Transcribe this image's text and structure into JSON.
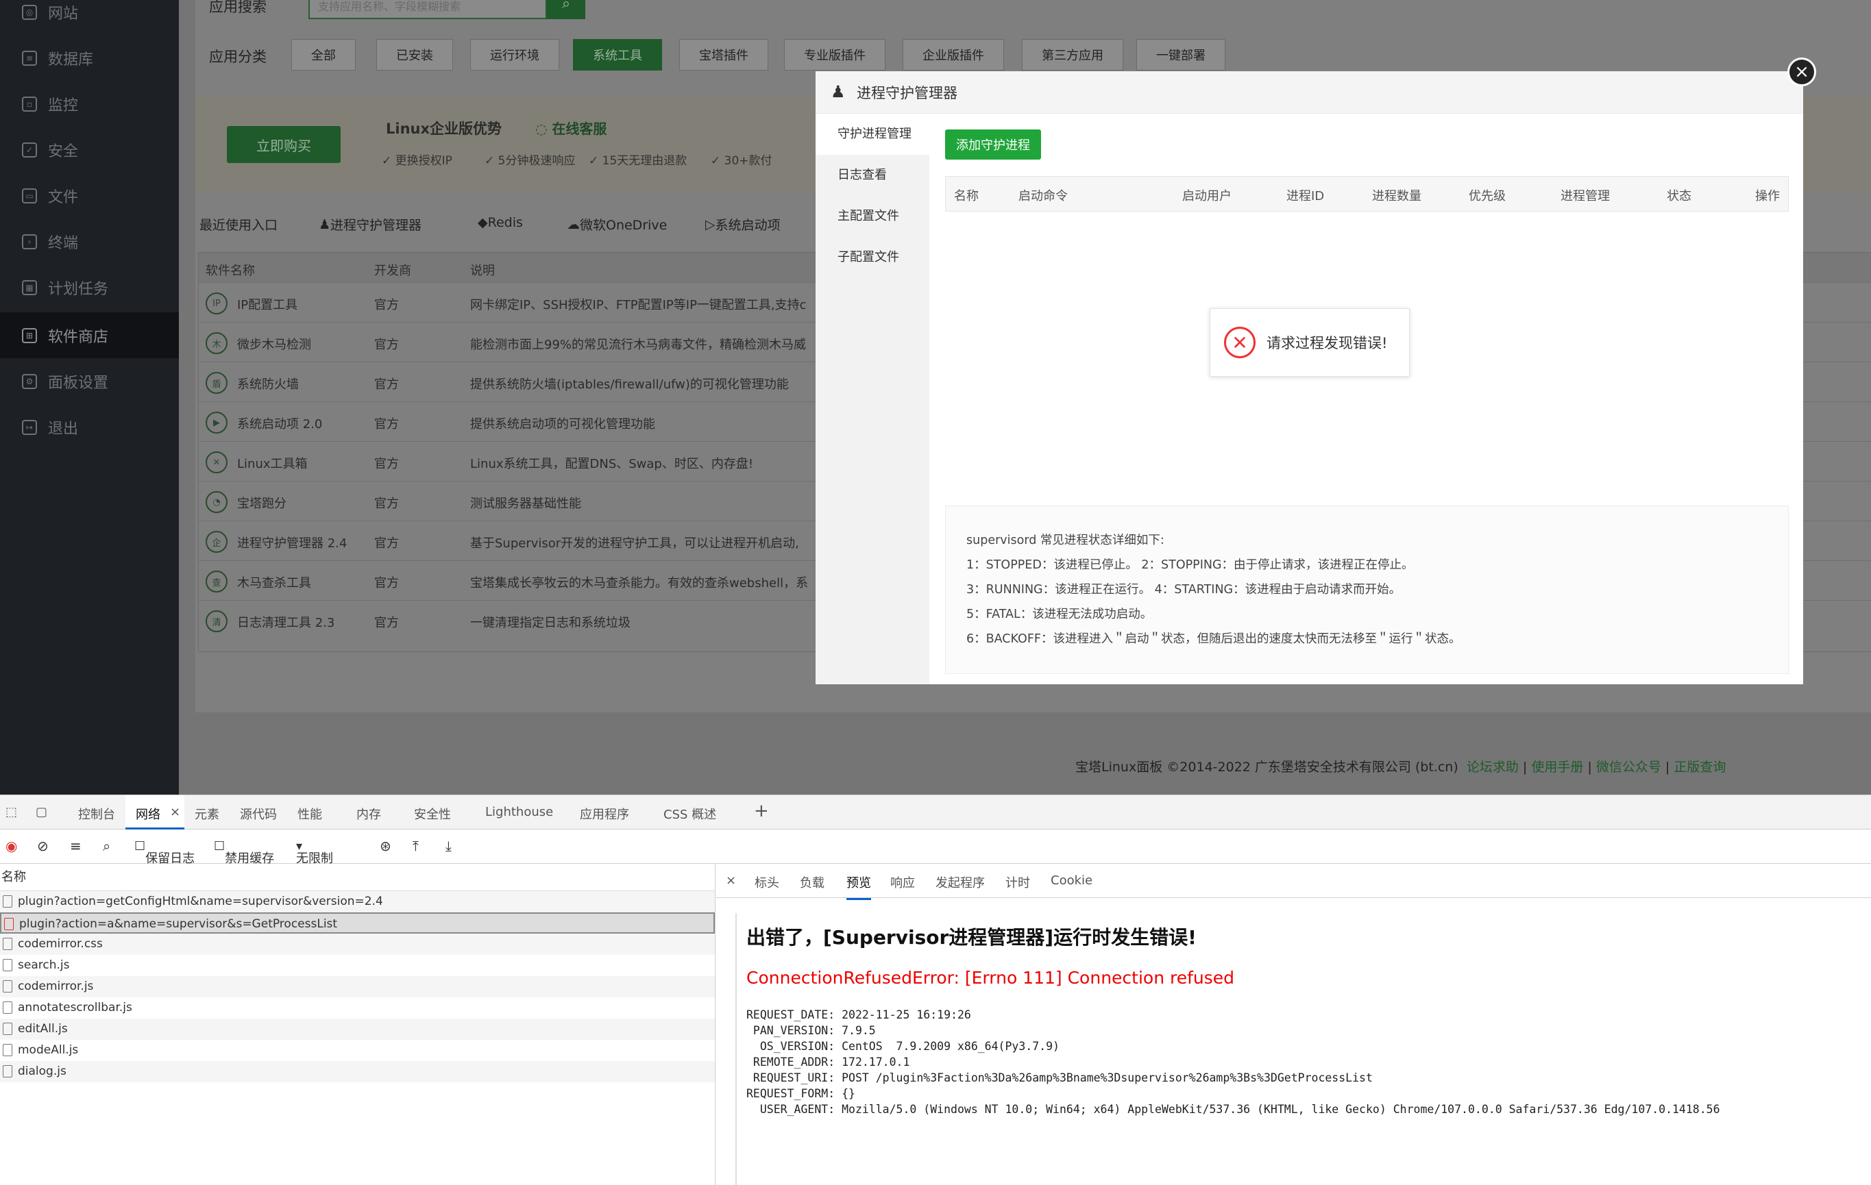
{
  "sidebar": {
    "items": [
      {
        "label": "网站",
        "icon": "globe-icon"
      },
      {
        "label": "数据库",
        "icon": "database-icon"
      },
      {
        "label": "监控",
        "icon": "monitor-icon"
      },
      {
        "label": "安全",
        "icon": "shield-icon"
      },
      {
        "label": "文件",
        "icon": "folder-icon"
      },
      {
        "label": "终端",
        "icon": "terminal-icon"
      },
      {
        "label": "计划任务",
        "icon": "calendar-icon"
      },
      {
        "label": "软件商店",
        "icon": "grid-icon"
      },
      {
        "label": "面板设置",
        "icon": "gear-icon"
      },
      {
        "label": "退出",
        "icon": "logout-icon"
      }
    ]
  },
  "store": {
    "search_label": "应用搜索",
    "search_placeholder": "支持应用名称、字段模糊搜索",
    "category_label": "应用分类",
    "categories": [
      "全部",
      "已安装",
      "运行环境",
      "系统工具",
      "宝塔插件",
      "专业版插件",
      "企业版插件",
      "第三方应用",
      "一键部署"
    ],
    "buy_label": "立即购买",
    "promo_title": "Linux企业版优势",
    "promo_service": "在线客服",
    "promo_features": [
      "更换授权IP",
      "5分钟极速响应",
      "15天无理由退款",
      "30+款付"
    ],
    "recent_label": "最近使用入口",
    "recent_items": [
      "进程守护管理器",
      "Redis",
      "微软OneDrive",
      "系统启动项"
    ],
    "table_headers": [
      "软件名称",
      "开发商",
      "说明"
    ],
    "rows": [
      {
        "icon": "IP",
        "name": "IP配置工具",
        "dev": "官方",
        "desc": "网卡绑定IP、SSH授权IP、FTP配置IP等IP一键配置工具,支持c"
      },
      {
        "icon": "木",
        "name": "微步木马检测",
        "dev": "官方",
        "desc": "能检测市面上99%的常见流行木马病毒文件，精确检测木马威"
      },
      {
        "icon": "盾",
        "name": "系统防火墙",
        "dev": "官方",
        "desc": "提供系统防火墙(iptables/firewall/ufw)的可视化管理功能"
      },
      {
        "icon": "▶",
        "name": "系统启动项 2.0",
        "dev": "官方",
        "desc": "提供系统启动项的可视化管理功能"
      },
      {
        "icon": "✕",
        "name": "Linux工具箱",
        "dev": "官方",
        "desc": "Linux系统工具，配置DNS、Swap、时区、内存盘!"
      },
      {
        "icon": "◔",
        "name": "宝塔跑分",
        "dev": "官方",
        "desc": "测试服务器基础性能"
      },
      {
        "icon": "企",
        "name": "进程守护管理器 2.4",
        "dev": "官方",
        "desc": "基于Supervisor开发的进程守护工具，可以让进程开机启动,"
      },
      {
        "icon": "查",
        "name": "木马查杀工具",
        "dev": "官方",
        "desc": "宝塔集成长亭牧云的木马查杀能力。有效的查杀webshell，系"
      },
      {
        "icon": "清",
        "name": "日志清理工具 2.3",
        "dev": "官方",
        "desc": "一键清理指定日志和系统垃圾"
      }
    ],
    "footer_text": "宝塔Linux面板 ©2014-2022 广东堡塔安全技术有限公司 (bt.cn)",
    "footer_links": [
      "论坛求助",
      "使用手册",
      "微信公众号",
      "正版查询"
    ]
  },
  "modal": {
    "title": "进程守护管理器",
    "nav": [
      "守护进程管理",
      "日志查看",
      "主配置文件",
      "子配置文件"
    ],
    "add_button": "添加守护进程",
    "columns": [
      "名称",
      "启动命令",
      "启动用户",
      "进程ID",
      "进程数量",
      "优先级",
      "进程管理",
      "状态",
      "操作"
    ],
    "error_message": "请求过程发现错误!",
    "tips": [
      "supervisord 常见进程状态详细如下:",
      "1：STOPPED：该进程已停止。     2：STOPPING：由于停止请求，该进程正在停止。",
      "3：RUNNING：该进程正在运行。 4：STARTING：该进程由于启动请求而开始。",
      "5：FATAL：该进程无法成功启动。",
      "6：BACKOFF：该进程进入＂启动＂状态，但随后退出的速度太快而无法移至＂运行＂状态。"
    ]
  },
  "devtools": {
    "tabs": [
      "控制台",
      "网络",
      "元素",
      "源代码",
      "性能",
      "内存",
      "安全性",
      "Lighthouse",
      "应用程序",
      "CSS 概述"
    ],
    "toolbar": {
      "preserve_log": "保留日志",
      "disable_cache": "禁用缓存",
      "throttle": "无限制"
    },
    "list_header": "名称",
    "requests": [
      "plugin?action=getConfigHtml&name=supervisor&version=2.4",
      "plugin?action=a&name=supervisor&s=GetProcessList",
      "codemirror.css",
      "search.js",
      "codemirror.js",
      "annotatescrollbar.js",
      "editAll.js",
      "modeAll.js",
      "dialog.js"
    ],
    "detail_tabs": [
      "标头",
      "负载",
      "预览",
      "响应",
      "发起程序",
      "计时",
      "Cookie"
    ],
    "preview": {
      "title": "出错了，[Supervisor进程管理器]运行时发生错误!",
      "error": "ConnectionRefusedError: [Errno 111] Connection refused",
      "details": "REQUEST_DATE: 2022-11-25 16:19:26\n PAN_VERSION: 7.9.5\n  OS_VERSION: CentOS  7.9.2009 x86_64(Py3.7.9)\n REMOTE_ADDR: 172.17.0.1\n REQUEST_URI: POST /plugin%3Faction%3Da%26amp%3Bname%3Dsupervisor%26amp%3Bs%3DGetProcessList\nREQUEST_FORM: {}\n  USER_AGENT: Mozilla/5.0 (Windows NT 10.0; Win64; x64) AppleWebKit/537.36 (KHTML, like Gecko) Chrome/107.0.0.0 Safari/537.36 Edg/107.0.1418.56"
    }
  },
  "colors": {
    "accent": "#20a53a",
    "error": "#ee0000",
    "devtools_active": "#0a64c8"
  }
}
